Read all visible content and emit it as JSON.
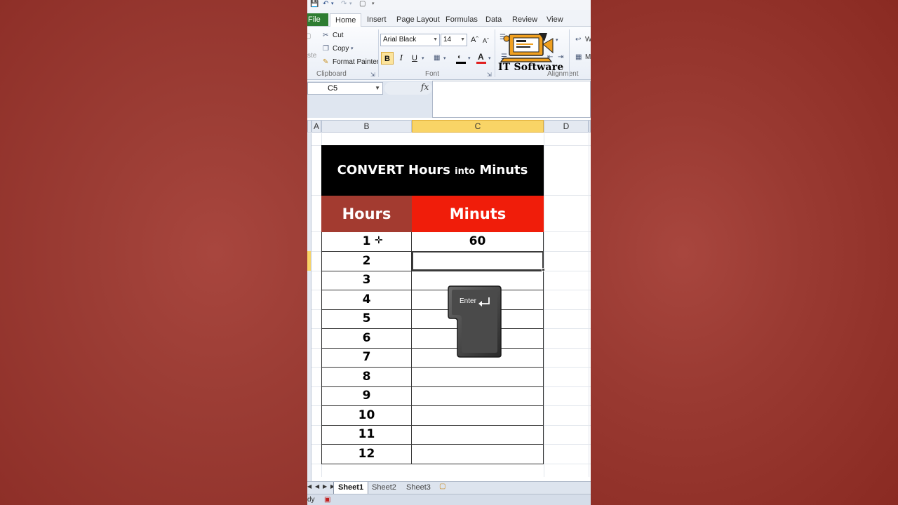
{
  "quick_access": {
    "save_icon": "save-icon",
    "undo_icon": "undo-icon",
    "redo_icon": "redo-icon"
  },
  "ribbon": {
    "tabs": [
      {
        "label": "File"
      },
      {
        "label": "Home"
      },
      {
        "label": "Insert"
      },
      {
        "label": "Page Layout"
      },
      {
        "label": "Formulas"
      },
      {
        "label": "Data"
      },
      {
        "label": "Review"
      },
      {
        "label": "View"
      }
    ],
    "active_tab": "Home",
    "clipboard": {
      "cut": "Cut",
      "copy": "Copy",
      "format_painter": "Format Painter",
      "group_label": "Clipboard",
      "paste_fragment": "ste"
    },
    "font": {
      "family": "Arial Black",
      "size": "14",
      "bold": "B",
      "italic": "I",
      "underline": "U",
      "group_label": "Font"
    },
    "alignment": {
      "group_label": "Alignment"
    },
    "logo_text": "IT Software",
    "wrap_fragment": "W",
    "merge_fragment": "M"
  },
  "formula_bar": {
    "name_box": "C5",
    "fx_label": "fx",
    "formula": ""
  },
  "grid": {
    "columns": [
      "A",
      "B",
      "C",
      "D"
    ],
    "selected_column": "C"
  },
  "table": {
    "title_part1": "CONVERT Hours",
    "title_small": "into",
    "title_part2": "Minuts",
    "col_hours": "Hours",
    "col_minutes": "Minuts",
    "rows": [
      {
        "hours": "1",
        "minutes": "60"
      },
      {
        "hours": "2",
        "minutes": ""
      },
      {
        "hours": "3",
        "minutes": ""
      },
      {
        "hours": "4",
        "minutes": ""
      },
      {
        "hours": "5",
        "minutes": ""
      },
      {
        "hours": "6",
        "minutes": ""
      },
      {
        "hours": "7",
        "minutes": ""
      },
      {
        "hours": "8",
        "minutes": ""
      },
      {
        "hours": "9",
        "minutes": ""
      },
      {
        "hours": "10",
        "minutes": ""
      },
      {
        "hours": "11",
        "minutes": ""
      },
      {
        "hours": "12",
        "minutes": ""
      }
    ]
  },
  "enter_key": {
    "label": "Enter"
  },
  "sheets": {
    "tabs": [
      "Sheet1",
      "Sheet2",
      "Sheet3"
    ],
    "active": "Sheet1"
  },
  "status": {
    "text": "dy"
  },
  "colors": {
    "title_bg": "#000000",
    "hours_header": "#a33b30",
    "minutes_header": "#f01d0a",
    "selection": "#f9d466",
    "file_tab": "#2e7d32",
    "background": "#9c3d35"
  }
}
